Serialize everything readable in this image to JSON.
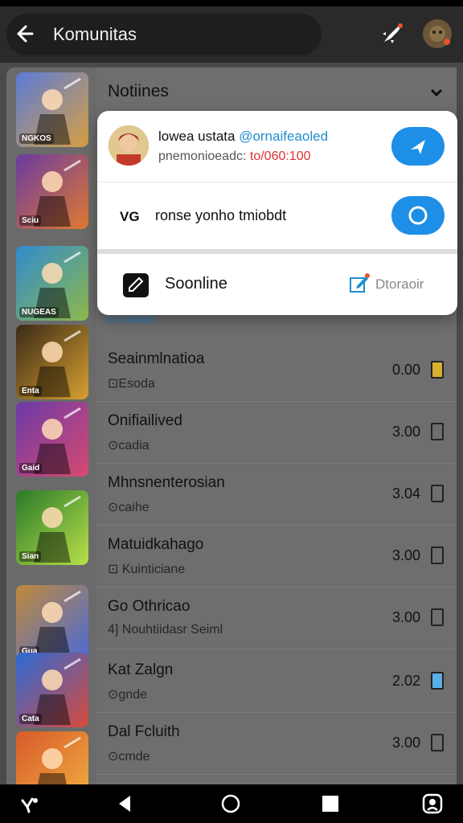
{
  "header": {
    "title": "Komunitas"
  },
  "panel": {
    "heading": "Notiines",
    "hint": "or intravoi"
  },
  "popup": {
    "item1": {
      "title": "lowea ustata",
      "title_accent": "@ornaifeaoled",
      "sub": "pnemonioeadc:",
      "sub_red": "to/060:100"
    },
    "item2": {
      "lead": "VG",
      "text": "ronse yonho tmiobdt"
    },
    "item3": {
      "text": "Soonline",
      "right": "Dtoraoir"
    }
  },
  "rows": [
    {
      "title": "Seainmlnatioa",
      "sub": "⊡Esoda",
      "value": "0.00"
    },
    {
      "title": "Onifiailived",
      "sub": "⊙cadia",
      "value": "3.00"
    },
    {
      "title": "Mhnsnenterosian",
      "sub": "⊙caihe",
      "value": "3.04"
    },
    {
      "title": "Matuidkahago",
      "sub": "⊡ Kuinticiane",
      "value": "3.00"
    },
    {
      "title": "Go Othricao",
      "sub": "4] Nouhtiidasr Seiml",
      "value": "3.00"
    },
    {
      "title": "Kat Zalgn",
      "sub": "⊙gnde",
      "value": "2.02"
    },
    {
      "title": "Dal Fcluith",
      "sub": "⊙cmde",
      "value": "3.00"
    }
  ],
  "thumbs": [
    {
      "label": "NGKOS",
      "c1": "#5a7bd8",
      "c2": "#d8a042"
    },
    {
      "label": "Sciu",
      "c1": "#6a3aa0",
      "c2": "#e07a30"
    },
    {
      "label": "NUGEAS",
      "c1": "#2f8ccf",
      "c2": "#8fb84a"
    },
    {
      "label": "Enta",
      "c1": "#3a2a18",
      "c2": "#d8a030"
    },
    {
      "label": "Gaid",
      "c1": "#6a3aa8",
      "c2": "#d84a70"
    },
    {
      "label": "Sian",
      "c1": "#2a7a2a",
      "c2": "#b8e04a"
    },
    {
      "label": "Gua",
      "c1": "#c08a3a",
      "c2": "#4a6ad8"
    },
    {
      "label": "Cata",
      "c1": "#2a6ad8",
      "c2": "#d84a3a"
    },
    {
      "label": "",
      "c1": "#d85a2a",
      "c2": "#f0b040"
    }
  ],
  "colors": {
    "accent": "#1e8fe6",
    "panel": "#6e6e6e",
    "header": "#2a2a2a"
  }
}
